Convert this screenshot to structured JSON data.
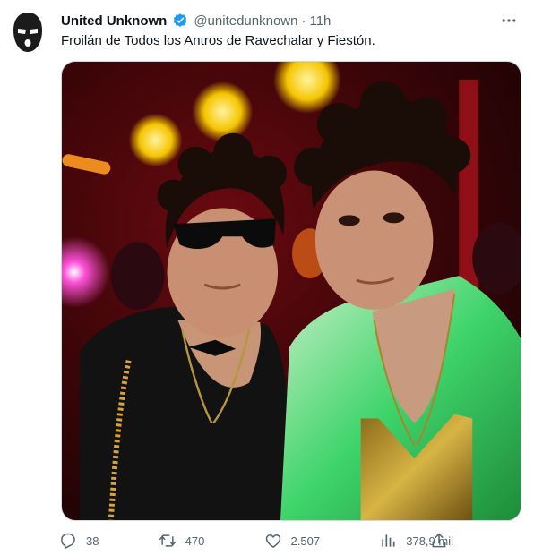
{
  "tweet": {
    "author_name": "United Unknown",
    "handle": "@unitedunknown",
    "separator": "·",
    "time": "11h",
    "text": "Froilán de Todos los Antros de Ravechalar y Fiestón.",
    "verified_color": "#1d9bf0"
  },
  "icons": {
    "avatar": "balaclava-mask-icon",
    "verified": "verified-badge-icon",
    "more": "more-dots-icon",
    "reply": "reply-icon",
    "retweet": "retweet-icon",
    "like": "heart-icon",
    "views": "views-bar-icon",
    "share": "share-icon"
  },
  "actions": {
    "replies": "38",
    "retweets": "470",
    "likes": "2.507",
    "views": "378,9 mil"
  }
}
